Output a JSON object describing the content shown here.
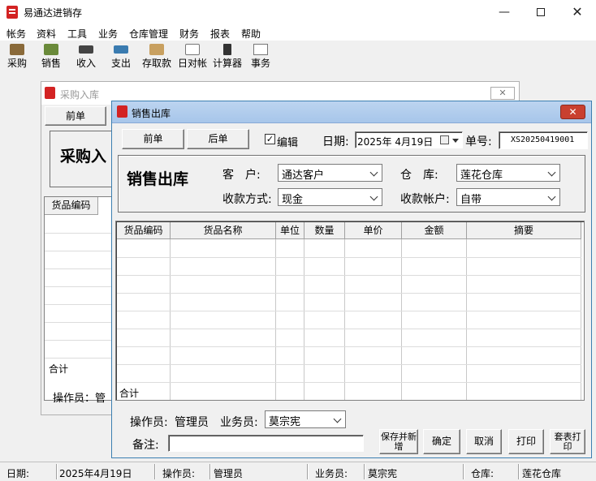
{
  "app": {
    "title": "易通达进销存"
  },
  "menu": [
    "帐务",
    "资料",
    "工具",
    "业务",
    "仓库管理",
    "财务",
    "报表",
    "帮助"
  ],
  "toolbar": [
    {
      "label": "采购",
      "icon": "purchase-icon"
    },
    {
      "label": "销售",
      "icon": "sales-icon"
    },
    {
      "label": "收入",
      "icon": "income-icon"
    },
    {
      "label": "支出",
      "icon": "expense-icon"
    },
    {
      "label": "存取款",
      "icon": "deposit-icon"
    },
    {
      "label": "日对帐",
      "icon": "daily-reconcile-icon"
    },
    {
      "label": "计算器",
      "icon": "calculator-icon"
    },
    {
      "label": "事务",
      "icon": "affairs-icon"
    }
  ],
  "back_window": {
    "title": "采购入库",
    "prev_label": "前单",
    "heading": "采购入",
    "col1": "货品编码",
    "total_label": "合计",
    "operator_label": "操作员：管"
  },
  "front_window": {
    "title": "销售出库",
    "prev_label": "前单",
    "next_label": "后单",
    "edit_label": "编辑",
    "date_label": "日期:",
    "date_value": "2025年 4月19日",
    "number_label": "单号:",
    "number_value": "XS20250419001",
    "heading": "销售出库",
    "customer_label": "客　户:",
    "customer_value": "通达客户",
    "warehouse_label": "仓　库:",
    "warehouse_value": "莲花仓库",
    "payment_label": "收款方式:",
    "payment_value": "现金",
    "account_label": "收款帐户:",
    "account_value": "自带",
    "columns": [
      "货品编码",
      "货品名称",
      "单位",
      "数量",
      "单价",
      "金额",
      "摘要"
    ],
    "total_label": "合计",
    "operator_label": "操作员:",
    "operator_value": "管理员",
    "salesman_label": "业务员:",
    "salesman_value": "莫宗宪",
    "remark_label": "备注:",
    "btn_save_new": "保存并新增",
    "btn_ok": "确定",
    "btn_cancel": "取消",
    "btn_print": "打印",
    "btn_template_print": "套表打印"
  },
  "status": {
    "date_label": "日期:",
    "date_value": "2025年4月19日",
    "operator_label": "操作员:",
    "operator_value": "管理员",
    "salesman_label": "业务员:",
    "salesman_value": "莫宗宪",
    "warehouse_label": "仓库:",
    "warehouse_value": "莲花仓库"
  },
  "colors": {
    "accent_title": "#a7c6ea",
    "close_red": "#c9402f",
    "brand_red": "#d32323"
  }
}
